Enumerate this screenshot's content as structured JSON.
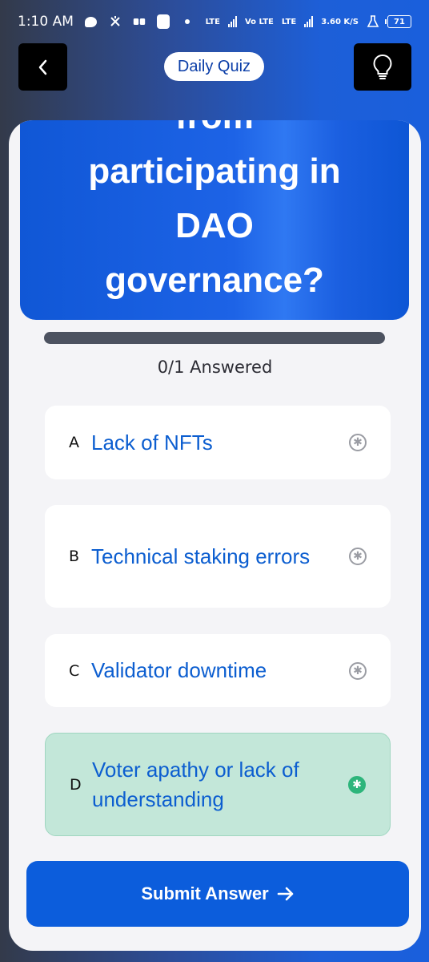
{
  "status_bar": {
    "time": "1:10 AM",
    "network_1": "LTE",
    "network_2": "Vo LTE",
    "network_3": "LTE",
    "speed": "3.60 K/S",
    "battery": "71"
  },
  "header": {
    "title": "Daily Quiz",
    "back_icon": "chevron-left-icon",
    "hint_icon": "lightbulb-icon"
  },
  "question": {
    "lines": [
      "from",
      "participating in",
      "DAO",
      "governance?"
    ]
  },
  "progress": {
    "answered_text": "0/1 Answered",
    "fraction": 0
  },
  "options": [
    {
      "letter": "A",
      "text": "Lack of NFTs",
      "selected": false
    },
    {
      "letter": "B",
      "text": "Technical staking errors",
      "selected": false
    },
    {
      "letter": "C",
      "text": "Validator downtime",
      "selected": false
    },
    {
      "letter": "D",
      "text": "Voter apathy or lack of understanding",
      "selected": true
    }
  ],
  "submit": {
    "label": "Submit Answer",
    "icon": "arrow-right-icon"
  },
  "colors": {
    "accent": "#0c5ddc",
    "selected_bg": "#c3e7d9",
    "selected_check": "#2db57b"
  }
}
